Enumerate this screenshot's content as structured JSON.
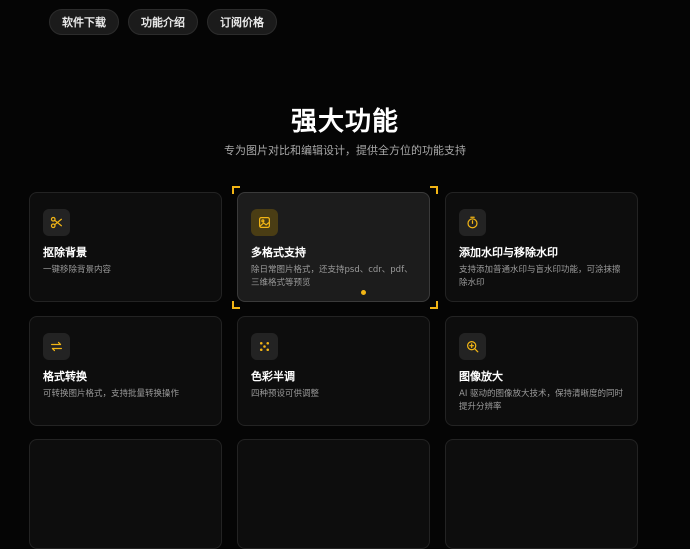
{
  "nav": {
    "items": [
      {
        "label": "软件下载"
      },
      {
        "label": "功能介绍"
      },
      {
        "label": "订阅价格"
      }
    ]
  },
  "hero": {
    "title": "强大功能",
    "subtitle": "专为图片对比和编辑设计，提供全方位的功能支持"
  },
  "colors": {
    "accent": "#f2b515",
    "background": "#050505",
    "card": "#0d0d0d"
  },
  "features": [
    {
      "icon": "scissors-icon",
      "title": "抠除背景",
      "desc": "一键移除背景内容"
    },
    {
      "icon": "image-icon",
      "title": "多格式支持",
      "desc": "除日常图片格式，还支持psd、cdr、pdf、三维格式等预览"
    },
    {
      "icon": "stopwatch-icon",
      "title": "添加水印与移除水印",
      "desc": "支持添加普通水印与盲水印功能，可涂抹擦除水印"
    },
    {
      "icon": "swap-arrows-icon",
      "title": "格式转换",
      "desc": "可转换图片格式，支持批量转换操作"
    },
    {
      "icon": "color-dots-icon",
      "title": "色彩半调",
      "desc": "四种预设可供调整"
    },
    {
      "icon": "zoom-in-icon",
      "title": "图像放大",
      "desc": "AI 驱动的图像放大技术，保持清晰度的同时提升分辨率"
    }
  ]
}
